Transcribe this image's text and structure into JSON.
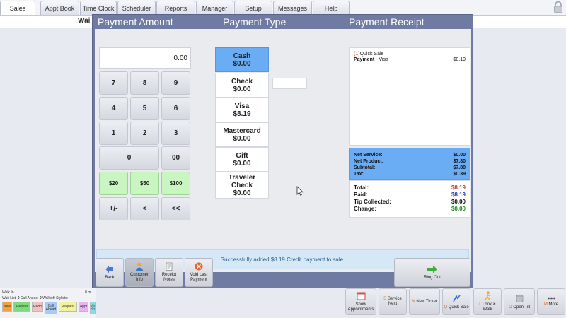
{
  "top_tabs": [
    "Sales",
    "Appt Book",
    "Time Clock",
    "Scheduler",
    "Reports",
    "Manager",
    "Setup",
    "Messages",
    "Help"
  ],
  "under_text": "Wai",
  "dialog": {
    "headers": {
      "amount": "Payment Amount",
      "type": "Payment Type",
      "receipt": "Payment Receipt"
    },
    "amount_value": "0.00",
    "keypad": [
      "7",
      "8",
      "9",
      "4",
      "5",
      "6",
      "1",
      "2",
      "3",
      "0",
      "00"
    ],
    "quick_amounts": [
      "$20",
      "$50",
      "$100"
    ],
    "controls": [
      "+/-",
      "<",
      "<<"
    ],
    "payment_types": [
      {
        "name": "Cash",
        "amount": "$0.00",
        "selected": true
      },
      {
        "name": "Check",
        "amount": "$0.00",
        "selected": false
      },
      {
        "name": "Visa",
        "amount": "$8.19",
        "selected": false
      },
      {
        "name": "Mastercard",
        "amount": "$0.00",
        "selected": false
      },
      {
        "name": "Gift",
        "amount": "$0.00",
        "selected": false
      },
      {
        "name": "Traveler Check",
        "amount": "$0.00",
        "selected": false
      }
    ],
    "receipt": {
      "index": "(1)",
      "sale_label": "Quick Sale",
      "payment_label": "Payment",
      "payment_method": " - Visa",
      "payment_amount": "$8.19"
    },
    "subtotals": [
      {
        "label": "Net Service:",
        "value": "$0.00"
      },
      {
        "label": "Net Product:",
        "value": "$7.80"
      },
      {
        "label": "Subtotal:",
        "value": "$7.80"
      },
      {
        "label": "Tax:",
        "value": "$0.39"
      }
    ],
    "totals": [
      {
        "label": "Total:",
        "value": "$8.19",
        "color": "#c0392b"
      },
      {
        "label": "Paid:",
        "value": "$8.19",
        "color": "#1f3bb3"
      },
      {
        "label": "Tip Collected:",
        "value": "$0.00",
        "color": "#111111"
      },
      {
        "label": "Change:",
        "value": "$0.00",
        "color": "#1a8a1a"
      }
    ],
    "status_message": "Successfully added $8.19 Credit payment to sale.",
    "buttons": [
      {
        "label": "Back",
        "icon": "back-arrow-icon"
      },
      {
        "label": "Customer Info",
        "icon": "customer-icon"
      },
      {
        "label": "Receipt Notes",
        "icon": "notes-icon"
      },
      {
        "label": "Void Last Payment",
        "icon": "void-icon"
      }
    ],
    "ring_out": {
      "label": "Ring Out",
      "icon": "ring-out-icon"
    }
  },
  "bottom_left": {
    "walk_in": "Walk In",
    "time": "0 m",
    "wait_list_label": "Wait List:",
    "wait_list_value": "0",
    "call_ahead_label": "Call Ahead:",
    "call_ahead_value": "0",
    "walks_label": "Walks:",
    "walks_value": "0",
    "stylists_label": "Stylists:",
    "chips": [
      {
        "label": "New",
        "color": "#f3a13a"
      },
      {
        "label": "Repeat",
        "color": "#7ddb7d"
      },
      {
        "label": "Redo",
        "color": "#f2c0c0"
      },
      {
        "label": "Call Ahead",
        "color": "#a9c9f3"
      },
      {
        "label": "Request",
        "color": "#f3f39a"
      },
      {
        "label": "Appt",
        "color": "#e9b3f3"
      },
      {
        "label": "Online Tckst",
        "color": "#7fe0ec"
      }
    ]
  },
  "bottom_buttons": [
    {
      "key": "",
      "label": "Show Appointments"
    },
    {
      "key": "S",
      "label": "Service Next"
    },
    {
      "key": "N",
      "label": "New Ticket"
    },
    {
      "key": "Q",
      "label": "Quick Sale"
    },
    {
      "key": "L",
      "label": "Look & Walk"
    },
    {
      "key": "O",
      "label": "Open Till"
    },
    {
      "key": "M",
      "label": "More"
    }
  ]
}
